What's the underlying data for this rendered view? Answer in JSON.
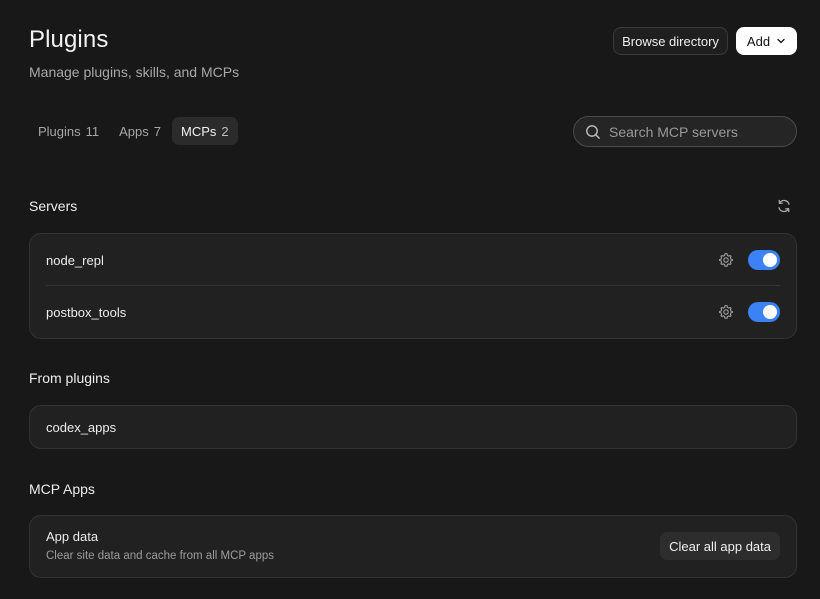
{
  "header": {
    "title": "Plugins",
    "subtitle": "Manage plugins, skills, and MCPs",
    "browse_label": "Browse directory",
    "add_label": "Add"
  },
  "tabs": [
    {
      "label": "Plugins",
      "count": "11",
      "active": false
    },
    {
      "label": "Apps",
      "count": "7",
      "active": false
    },
    {
      "label": "MCPs",
      "count": "2",
      "active": true
    }
  ],
  "search": {
    "placeholder": "Search MCP servers",
    "value": ""
  },
  "servers": {
    "label": "Servers",
    "items": [
      {
        "name": "node_repl",
        "enabled": true
      },
      {
        "name": "postbox_tools",
        "enabled": true
      }
    ]
  },
  "from_plugins": {
    "label": "From plugins",
    "items": [
      {
        "name": "codex_apps"
      }
    ]
  },
  "mcp_apps": {
    "label": "MCP Apps",
    "app_data_title": "App data",
    "app_data_desc": "Clear site data and cache from all MCP apps",
    "clear_label": "Clear all app data"
  },
  "colors": {
    "accent": "#3b82f6",
    "background": "#181818",
    "card": "#212121"
  },
  "icons": [
    "search-icon",
    "refresh-icon",
    "gear-icon",
    "chevron-down-icon"
  ]
}
